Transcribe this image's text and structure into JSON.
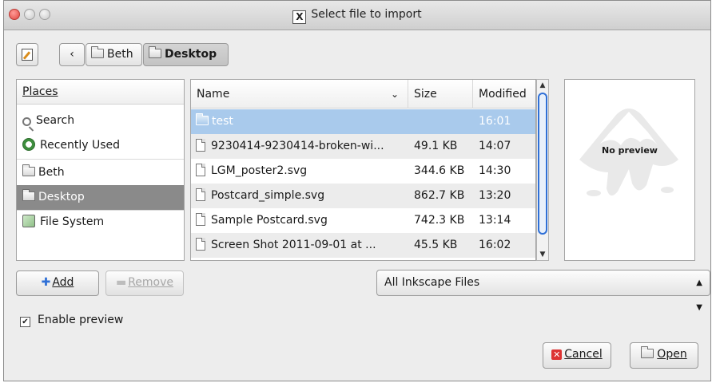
{
  "window": {
    "title": "Select file to import",
    "title_icon": "X"
  },
  "toolbar": {
    "back_label": "‹",
    "breadcrumbs": [
      "Beth",
      "Desktop"
    ]
  },
  "places": {
    "header": "Places",
    "items": [
      {
        "label": "Search",
        "icon": "search-icon"
      },
      {
        "label": "Recently Used",
        "icon": "recent-icon"
      },
      {
        "label": "Beth",
        "icon": "folder-icon"
      },
      {
        "label": "Desktop",
        "icon": "folder-icon",
        "selected": true
      },
      {
        "label": "File System",
        "icon": "drive-icon"
      }
    ]
  },
  "files": {
    "columns": [
      "Name",
      "Size",
      "Modified"
    ],
    "rows": [
      {
        "name": "test",
        "size": "",
        "modified": "16:01",
        "type": "folder",
        "selected": true
      },
      {
        "name": "9230414-9230414-broken-wi...",
        "size": "49.1 KB",
        "modified": "14:07",
        "type": "file"
      },
      {
        "name": "LGM_poster2.svg",
        "size": "344.6 KB",
        "modified": "14:30",
        "type": "file"
      },
      {
        "name": "Postcard_simple.svg",
        "size": "862.7 KB",
        "modified": "13:20",
        "type": "file"
      },
      {
        "name": "Sample Postcard.svg",
        "size": "742.3 KB",
        "modified": "13:14",
        "type": "file"
      },
      {
        "name": "Screen Shot 2011-09-01 at ...",
        "size": "45.5 KB",
        "modified": "16:02",
        "type": "file"
      }
    ]
  },
  "preview": {
    "text": "No preview"
  },
  "buttons": {
    "add": "Add",
    "remove": "Remove",
    "cancel": "Cancel",
    "open": "Open"
  },
  "filter": {
    "selected": "All Inkscape Files"
  },
  "enable_preview": {
    "label": "Enable preview",
    "checked": true
  },
  "colors": {
    "selection_blue": "#a9caec",
    "places_selected": "#8a8a8a",
    "scroll_accent": "#2e6fd6"
  }
}
